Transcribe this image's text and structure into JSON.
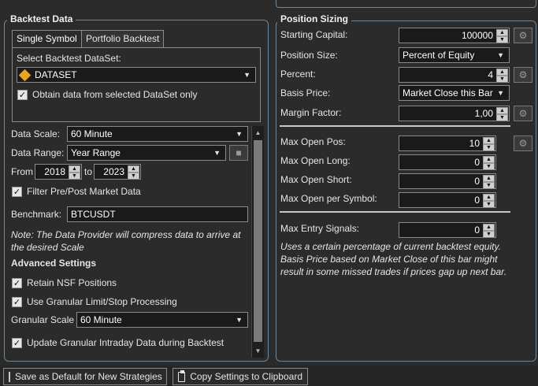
{
  "backtest": {
    "title": "Backtest Data",
    "tabs": [
      "Single Symbol",
      "Portfolio Backtest"
    ],
    "select_dataset_label": "Select Backtest DataSet:",
    "dataset_value": "DATASET",
    "obtain_only_label": "Obtain data from selected DataSet only",
    "data_scale_label": "Data Scale:",
    "data_scale_value": "60 Minute",
    "data_range_label": "Data Range:",
    "data_range_value": "Year Range",
    "from_label": "From",
    "from_value": "2018",
    "to_label": "to",
    "to_value": "2023",
    "filter_label": "Filter Pre/Post Market Data",
    "benchmark_label": "Benchmark:",
    "benchmark_value": "BTCUSDT",
    "note": "Note: The Data Provider will compress data to arrive at the desired Scale",
    "advanced_title": "Advanced Settings",
    "retain_nsf_label": "Retain NSF Positions",
    "granular_processing_label": "Use Granular Limit/Stop Processing",
    "granular_scale_label": "Granular Scale",
    "granular_scale_value": "60 Minute",
    "update_granular_label": "Update Granular Intraday Data during Backtest",
    "obtain_only_checked": true,
    "filter_checked": true,
    "retain_nsf_checked": true,
    "granular_processing_checked": true,
    "update_granular_checked": true
  },
  "sizing": {
    "title": "Position Sizing",
    "starting_capital_label": "Starting Capital:",
    "starting_capital_value": "100000",
    "position_size_label": "Position Size:",
    "position_size_value": "Percent of Equity",
    "percent_label": "Percent:",
    "percent_value": "4",
    "basis_price_label": "Basis Price:",
    "basis_price_value": "Market Close this Bar",
    "margin_factor_label": "Margin Factor:",
    "margin_factor_value": "1,00",
    "max_open_pos_label": "Max Open Pos:",
    "max_open_pos_value": "10",
    "max_open_long_label": "Max Open Long:",
    "max_open_long_value": "0",
    "max_open_short_label": "Max Open Short:",
    "max_open_short_value": "0",
    "max_open_symbol_label": "Max Open per Symbol:",
    "max_open_symbol_value": "0",
    "max_entry_label": "Max Entry Signals:",
    "max_entry_value": "0",
    "description": "Uses a certain percentage of current backtest equity. Basis Price based on Market Close of this bar might result in some missed trades if prices gap up next bar."
  },
  "footer": {
    "save_default_label": "Save as Default for New Strategies",
    "save_default_checked": false,
    "copy_settings_label": "Copy Settings to Clipboard"
  },
  "icons": {
    "dataset": "dataset-diamond-icon",
    "save": "save-disk-icon",
    "optimize": "optimize-gear-icon",
    "clipboard": "clipboard-icon"
  },
  "colors": {
    "background": "#2b2b2b",
    "group_border": "#6f8797",
    "dataset_icon": "#e8a317"
  }
}
